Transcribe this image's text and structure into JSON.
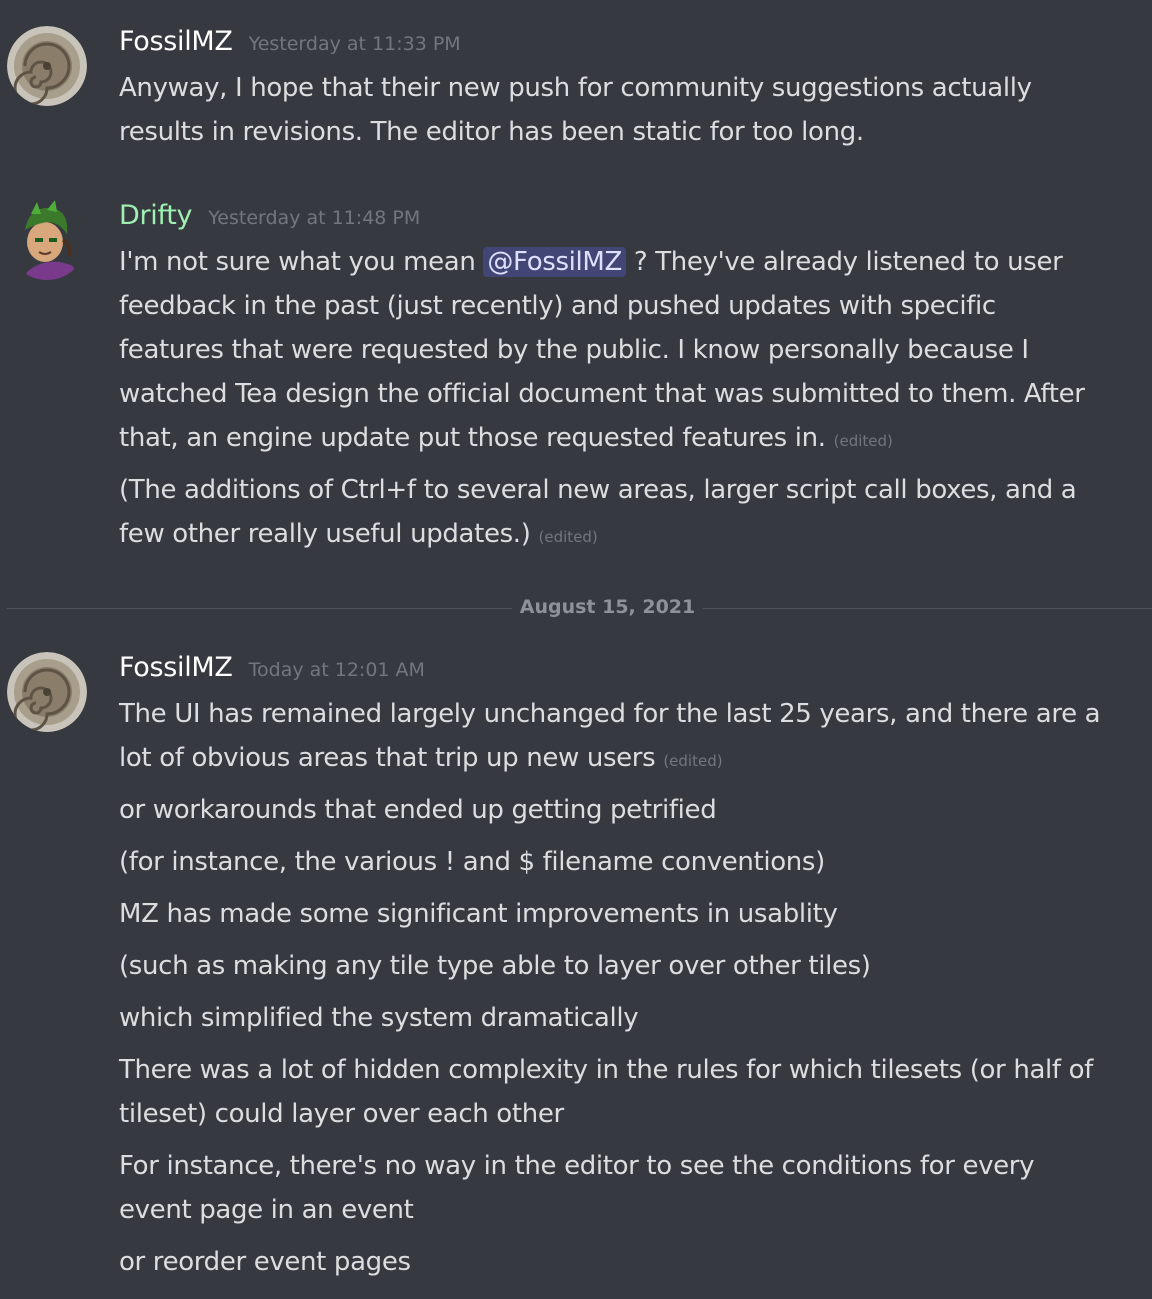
{
  "messages": [
    {
      "author": "FossilMZ",
      "timestamp": "Yesterday at 11:33 PM",
      "lines": [
        "Anyway, I hope that their new push for community suggestions actually",
        "results in revisions.  The editor has been static for too long."
      ]
    },
    {
      "author": "Drifty",
      "timestamp": "Yesterday at 11:48 PM",
      "line1_pre": "I'm not sure what you mean ",
      "mention": "@FossilMZ",
      "line1_post": " ? They've already listened to user",
      "lines": [
        "feedback in the past (just recently) and pushed updates with specific",
        "features that were requested by the public. I know personally because I",
        "watched Tea design the official document that was submitted to them. After",
        "that, an engine update put those requested features in."
      ],
      "followup": [
        "(The additions of Ctrl+f to several new areas, larger script call boxes, and a",
        "few other really useful updates.)"
      ]
    },
    {
      "author": "FossilMZ",
      "timestamp": "Today at 12:01 AM",
      "lines": [
        "The UI has remained largely unchanged for the last 25 years, and there are a",
        "lot of obvious areas that trip up new users",
        "or workarounds that ended up getting petrified",
        "(for instance, the various ! and $ filename conventions)",
        "MZ has made some significant improvements in usablity",
        "(such as making any tile type able to layer over other tiles)",
        "which simplified the system dramatically",
        "There was a lot of hidden complexity in the rules for which tilesets (or half of",
        "tileset) could layer over each other",
        "For instance, there's no way in the editor to see the conditions for every",
        "event page in an event",
        "or reorder event pages"
      ]
    }
  ],
  "edited_label": "(edited)",
  "date_divider": "August 15, 2021",
  "colors": {
    "background": "#36393f",
    "text": "#dcddde",
    "drifty_name": "#9ff0b2",
    "timestamp": "#72767d",
    "mention_bg": "#414675"
  },
  "icons": [
    "ammonite-fossil-avatar",
    "drifty-character-avatar"
  ]
}
